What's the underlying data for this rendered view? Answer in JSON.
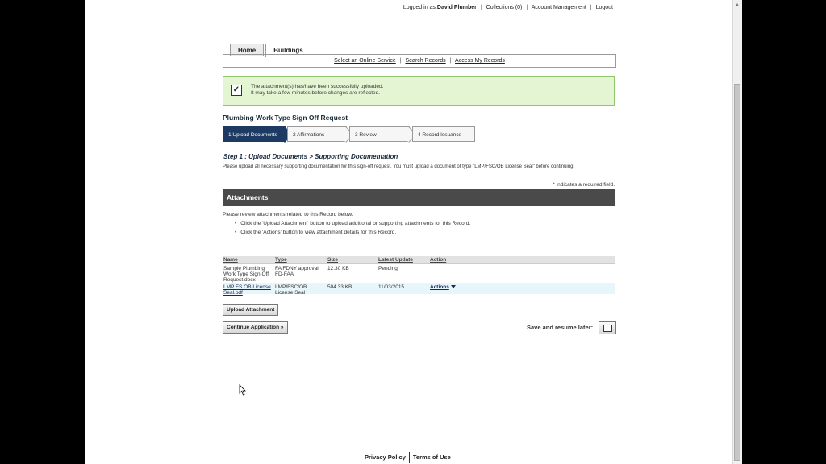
{
  "topbar": {
    "logged_in_prefix": "Logged in as:",
    "user_name": "David Plumber",
    "collections": "Collections (0)",
    "account_management": "Account Management",
    "logout": "Logout"
  },
  "tabs": [
    {
      "label": "Home"
    },
    {
      "label": "Buildings"
    }
  ],
  "subnav": {
    "online_service": "Select an Online Service",
    "search_records": "Search Records",
    "access_records": "Access My Records"
  },
  "notice": {
    "line1": "The attachment(s) has/have been successfully uploaded.",
    "line2": "It may take a few minutes before changes are reflected."
  },
  "page_title": "Plumbing Work Type Sign Off Request",
  "steps": [
    {
      "label": "1  Upload Documents"
    },
    {
      "label": "2  Affirmations"
    },
    {
      "label": "3  Review"
    },
    {
      "label": "4  Record Issuance"
    }
  ],
  "step_heading": "Step 1 : Upload Documents > Supporting Documentation",
  "intro_text": "Please upload all necessary supporting documentation for this sign-off request. You must upload a document of type \"LMP/FSC/OB License Seal\" before continuing.",
  "required_note": "indicates a required field.",
  "section_title": "Attachments",
  "review_text": "Please review attachments related to this Record below.",
  "bullets": [
    "Click the 'Upload Attachment' button to upload additional or supporting attachments for this Record.",
    "Click the 'Actions' button to view attachment details for this Record."
  ],
  "table": {
    "headers": {
      "name": "Name",
      "type": "Type",
      "size": "Size",
      "status": "Latest Update",
      "action": "Action"
    },
    "rows": [
      {
        "name": "Sample Plumbing Work Type Sign Off Request.docx",
        "type": "FA FDNY approval FD-FAA",
        "size": "12.30 KB",
        "status": "Pending",
        "action": ""
      },
      {
        "name": "LMP FS OB License Seal.pdf",
        "type": "LMP/FSC/OB License Seal",
        "size": "504.33 KB",
        "status": "11/03/2015",
        "action": "Actions"
      }
    ]
  },
  "buttons": {
    "upload": "Upload Attachment",
    "continue": "Continue Application »",
    "save_resume": "Save and resume later:"
  },
  "footer": {
    "privacy": "Privacy Policy",
    "terms": "Terms of Use"
  },
  "colors": {
    "step_active": "#1d3a63",
    "notice_bg": "#e3f5d2",
    "section_bar": "#4a4a4a"
  }
}
